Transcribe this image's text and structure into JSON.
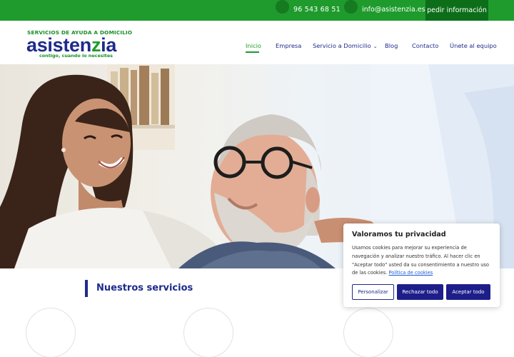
{
  "topbar": {
    "phone": "96 543 68 51",
    "email": "info@asistenzia.es",
    "cta": "pedir información"
  },
  "logo": {
    "tagline": "SERVICIOS DE AYUDA A DOMICILIO",
    "word_a": "asisten",
    "word_b": "z",
    "word_c": "ia",
    "sub": "contigo, cuando lo necesites"
  },
  "nav": {
    "items": [
      {
        "label": "Inicio",
        "active": true
      },
      {
        "label": "Empresa"
      },
      {
        "label": "Servicio a Domicilio",
        "has_dropdown": true
      },
      {
        "label": "Blog"
      },
      {
        "label": "Contacto"
      },
      {
        "label": "Únete al equipo"
      }
    ]
  },
  "sections": {
    "services_title": "Nuestros servicios"
  },
  "cookie": {
    "title": "Valoramos tu privacidad",
    "text": "Usamos cookies para mejorar su experiencia de navegación y analizar nuestro tráfico. Al hacer clic en \"Aceptar todo\" usted da su consentimiento a nuestro uso de las cookies.",
    "link": "Política de cookies",
    "customize": "Personalizar",
    "reject": "Rechazar todo",
    "accept": "Aceptar todo"
  },
  "colors": {
    "green": "#1e9b2c",
    "dark_green": "#0d6e1a",
    "navy": "#1e2a8c"
  }
}
